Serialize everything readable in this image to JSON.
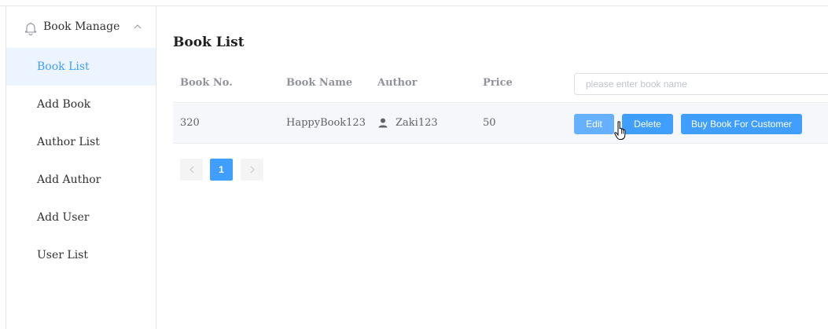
{
  "sidebar": {
    "group_title": "Book Manage",
    "items": [
      {
        "label": "Book List",
        "active": true
      },
      {
        "label": "Add Book"
      },
      {
        "label": "Author List"
      },
      {
        "label": "Add Author"
      },
      {
        "label": "Add User"
      },
      {
        "label": "User List"
      }
    ],
    "icons": {
      "group": "bell-icon",
      "toggle": "chevron-up-icon"
    }
  },
  "main": {
    "title": "Book List",
    "table": {
      "columns": [
        "Book No.",
        "Book Name",
        "Author",
        "Price"
      ],
      "search_placeholder": "please enter book name",
      "search_value": "",
      "rows": [
        {
          "book_no": "320",
          "book_name": "HappyBook123",
          "author": "Zaki123",
          "price": "50"
        }
      ],
      "actions": {
        "edit": "Edit",
        "delete": "Delete",
        "buy": "Buy Book For Customer"
      }
    },
    "pagination": {
      "current_page": "1"
    }
  },
  "colors": {
    "primary": "#409eff",
    "primary_hover": "#66b1ff",
    "active_bg": "#ecf5ff",
    "row_hover_bg": "#f5f7fa"
  }
}
